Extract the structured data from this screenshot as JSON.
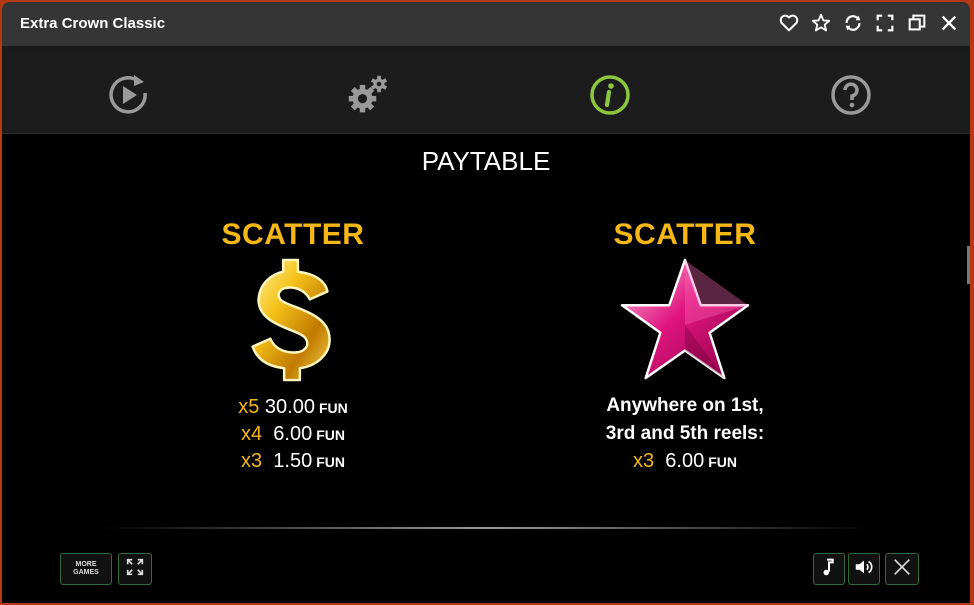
{
  "window": {
    "title": "Extra Crown Classic",
    "controls": [
      "heart-icon",
      "star-icon",
      "refresh-icon",
      "fullscreen-icon",
      "restore-icon",
      "close-icon"
    ]
  },
  "toolbar": {
    "items": [
      "autoplay-icon",
      "settings-icon",
      "info-icon",
      "help-icon"
    ],
    "active": "info-icon",
    "active_color": "#8cc63f"
  },
  "paytable": {
    "heading": "PAYTABLE",
    "left": {
      "title": "SCATTER",
      "symbol": "dollar-sign",
      "payouts": [
        {
          "mult": "x5",
          "amount": "30.00",
          "unit": "FUN"
        },
        {
          "mult": "x4",
          "amount": "6.00",
          "unit": "FUN"
        },
        {
          "mult": "x3",
          "amount": "1.50",
          "unit": "FUN"
        }
      ]
    },
    "right": {
      "title": "SCATTER",
      "symbol": "star",
      "desc_line1": "Anywhere on 1st,",
      "desc_line2": "3rd and 5th reels:",
      "payout": {
        "mult": "x3",
        "amount": "6.00",
        "unit": "FUN"
      }
    }
  },
  "bottom": {
    "more_games_line1": "MORE",
    "more_games_line2": "GAMES",
    "right_buttons": [
      "music-icon",
      "sound-icon",
      "close-icon"
    ]
  },
  "colors": {
    "accent": "#f5b716",
    "titlebar": "#353535",
    "frame": "#b33a14"
  }
}
